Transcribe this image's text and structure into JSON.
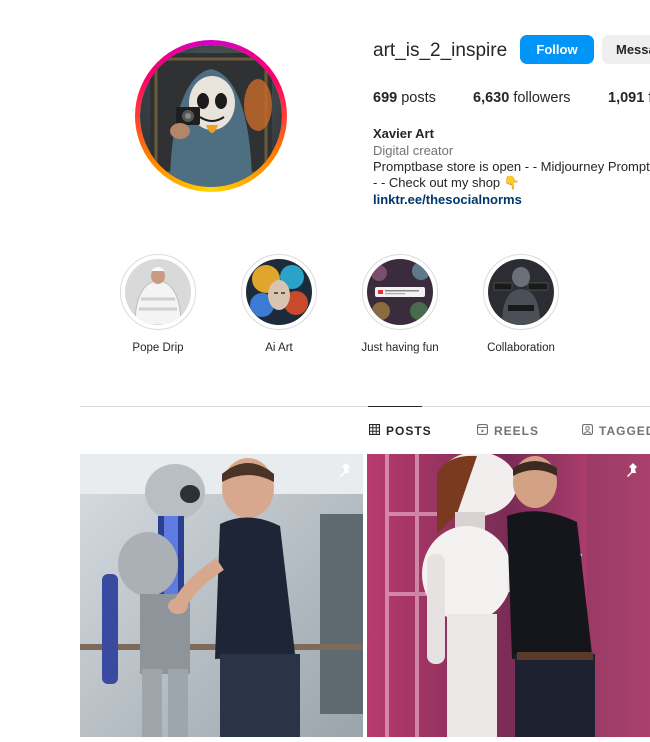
{
  "profile": {
    "username": "art_is_2_inspire",
    "follow_label": "Follow",
    "message_label": "Messa",
    "posts_count": "699",
    "posts_label": "posts",
    "followers_count": "6,630",
    "followers_label": "followers",
    "following_count": "1,091",
    "following_label": "f",
    "full_name": "Xavier Art",
    "category": "Digital creator",
    "bio_line1": "Promptbase store is open - - Midjourney Prompt",
    "bio_line2": "- - Check out my shop 👇",
    "link": "linktr.ee/thesocialnorms"
  },
  "highlights": [
    {
      "label": "Pope Drip"
    },
    {
      "label": "Ai Art"
    },
    {
      "label": "Just having fun"
    },
    {
      "label": "Collaboration"
    }
  ],
  "tabs": [
    {
      "label": "POSTS",
      "icon": "grid-icon",
      "active": true
    },
    {
      "label": "REELS",
      "icon": "reels-icon",
      "active": false
    },
    {
      "label": "TAGGED",
      "icon": "tagged-icon",
      "active": false
    }
  ],
  "posts": [
    {
      "pinned": true,
      "icon": "pin-icon"
    },
    {
      "pinned": true,
      "icon": "pin-icon"
    }
  ],
  "colors": {
    "accent": "#0095f6",
    "link": "#00376b",
    "muted": "#737373"
  }
}
